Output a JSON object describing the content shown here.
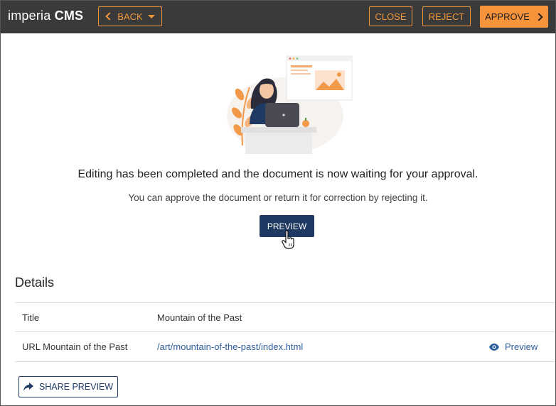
{
  "header": {
    "logo_light": "imperia ",
    "logo_bold": "CMS",
    "back_label": "BACK",
    "close_label": "CLOSE",
    "reject_label": "REJECT",
    "approve_label": "APPROVE"
  },
  "main": {
    "headline": "Editing has been completed and the document is now waiting for your approval.",
    "subline": "You can approve the document or return it for correction by rejecting it.",
    "preview_label": "PREVIEW"
  },
  "details": {
    "title": "Details",
    "rows": [
      {
        "label": "Title",
        "value": "Mountain of the Past"
      },
      {
        "label": "URL Mountain of the Past",
        "value": "/art/mountain-of-the-past/index.html",
        "action": "Preview"
      }
    ],
    "share_label": "SHARE PREVIEW"
  },
  "colors": {
    "topbar": "#3a3a3a",
    "accent": "#f7933a",
    "navy": "#1f3a62",
    "link": "#2d5d9b"
  },
  "icons": [
    "chevron-left-icon",
    "caret-down-icon",
    "chevron-right-icon",
    "eye-icon",
    "share-icon",
    "hand-cursor-icon"
  ]
}
